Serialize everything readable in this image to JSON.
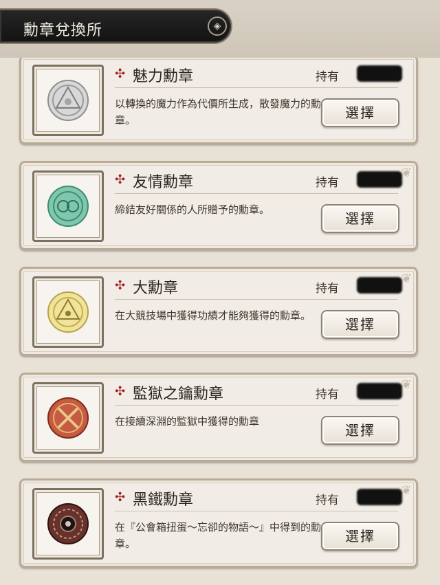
{
  "header": {
    "title": "勳章兌換所",
    "emblem_icon": "diamond-emblem-icon"
  },
  "medals": [
    {
      "name": "魅力勳章",
      "hold_label": "持有",
      "hold_value": "",
      "description": "以轉換的魔力作為代價所生成，散發魔力的勳章。",
      "button": "選擇",
      "icon": "charm-medal-icon",
      "color": "#c9c9c9"
    },
    {
      "name": "友情勳章",
      "hold_label": "持有",
      "hold_value": "",
      "description": "締結友好關係的人所贈予的勳章。",
      "button": "選擇",
      "icon": "friendship-medal-icon",
      "color": "#6fb89e"
    },
    {
      "name": "大勳章",
      "hold_label": "持有",
      "hold_value": "",
      "description": "在大競技場中獲得功績才能夠獲得的勳章。",
      "button": "選擇",
      "icon": "grand-medal-icon",
      "color": "#e6d478"
    },
    {
      "name": "監獄之鑰勳章",
      "hold_label": "持有",
      "hold_value": "",
      "description": "在接續深淵的監獄中獲得的勳章",
      "button": "選擇",
      "icon": "prison-key-medal-icon",
      "color": "#b5432f"
    },
    {
      "name": "黑鐵勳章",
      "hold_label": "持有",
      "hold_value": "",
      "description": "在『公會箱扭蛋～忘卻的物語～』中得到的勳章。",
      "button": "選擇",
      "icon": "black-iron-medal-icon",
      "color": "#5a2a24"
    }
  ]
}
